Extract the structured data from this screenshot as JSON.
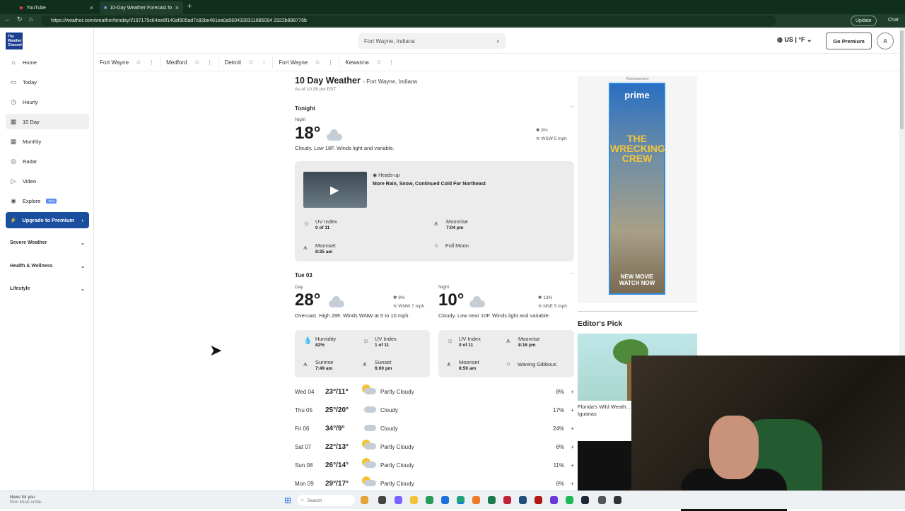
{
  "browser": {
    "tabs": [
      {
        "title": "YouTube",
        "active": false
      },
      {
        "title": "10-Day Weather Forecast for Fort...",
        "active": true
      }
    ],
    "url": "https://weather.com/weather/tenday/l/197175c64ee8f140af905ad7c82be481ea0a5604328311885094 2922b898776b",
    "update_label": "Update",
    "chat_label": "Chat"
  },
  "sidebar": {
    "logo_text": "The Weather Channel",
    "items": [
      {
        "label": "Home",
        "icon": "home-icon"
      },
      {
        "label": "Today",
        "icon": "calendar-icon"
      },
      {
        "label": "Hourly",
        "icon": "clock-icon"
      },
      {
        "label": "10 Day",
        "icon": "calendar-icon"
      },
      {
        "label": "Monthly",
        "icon": "calendar-icon"
      },
      {
        "label": "Radar",
        "icon": "radar-icon"
      },
      {
        "label": "Video",
        "icon": "play-icon"
      },
      {
        "label": "Explore",
        "icon": "compass-icon",
        "badge": "New"
      }
    ],
    "premium_label": "Upgrade to Premium",
    "sections": [
      "Severe Weather",
      "Health & Wellness",
      "Lifestyle"
    ]
  },
  "header": {
    "search_placeholder": "Fort Wayne, Indiana",
    "locale": "US | °F",
    "go_premium": "Go Premium",
    "avatar": "A"
  },
  "recent_locations": [
    "Fort Wayne",
    "Medford",
    "Detroit",
    "Fort Wayne",
    "Kewanna"
  ],
  "main": {
    "title": "10 Day Weather",
    "location": "- Fort Wayne, Indiana",
    "as_of": "As of 10:26 pm EST",
    "tonight": {
      "header": "Tonight",
      "period": "Night",
      "temp": "18°",
      "precip": "9%",
      "wind": "WSW 5 mph",
      "desc": "Cloudy. Low 18F. Winds light and variable.",
      "video_kicker": "Heads-up",
      "video_title": "More Rain, Snow, Continued Cold For Northeast",
      "details": [
        {
          "label": "UV Index",
          "value": "0 of 11"
        },
        {
          "label": "Moonrise",
          "value": "7:04 pm"
        },
        {
          "label": "Moonset",
          "value": "8:25 am"
        },
        {
          "label": "Full Moon",
          "value": ""
        }
      ]
    },
    "tue": {
      "header": "Tue 03",
      "day": {
        "period": "Day",
        "temp": "28°",
        "precip": "9%",
        "wind": "WNW 7 mph",
        "desc": "Overcast. High 28F. Winds WNW at 5 to 10 mph.",
        "details": [
          {
            "label": "Humidity",
            "value": "82%"
          },
          {
            "label": "UV Index",
            "value": "1 of 11"
          },
          {
            "label": "Sunrise",
            "value": "7:49 am"
          },
          {
            "label": "Sunset",
            "value": "6:00 pm"
          }
        ]
      },
      "night": {
        "period": "Night",
        "temp": "10°",
        "precip": "13%",
        "wind": "NNE 5 mph",
        "desc": "Cloudy. Low near 10F. Winds light and variable.",
        "details": [
          {
            "label": "UV Index",
            "value": "0 of 11"
          },
          {
            "label": "Moonrise",
            "value": "8:16 pm"
          },
          {
            "label": "Moonset",
            "value": "8:50 am"
          },
          {
            "label": "Waning Gibbous",
            "value": ""
          }
        ]
      }
    },
    "days": [
      {
        "day": "Wed 04",
        "temps": "23°/11°",
        "cond": "Partly Cloudy",
        "precip": "8%",
        "icon": "partly-cloudy-icon"
      },
      {
        "day": "Thu 05",
        "temps": "25°/20°",
        "cond": "Cloudy",
        "precip": "17%",
        "icon": "cloudy-icon"
      },
      {
        "day": "Fri 06",
        "temps": "34°/9°",
        "cond": "Cloudy",
        "precip": "24%",
        "icon": "cloudy-icon"
      },
      {
        "day": "Sat 07",
        "temps": "22°/13°",
        "cond": "Partly Cloudy",
        "precip": "6%",
        "icon": "partly-cloudy-icon"
      },
      {
        "day": "Sun 08",
        "temps": "26°/14°",
        "cond": "Partly Cloudy",
        "precip": "11%",
        "icon": "partly-cloudy-icon"
      },
      {
        "day": "Mon 09",
        "temps": "29°/17°",
        "cond": "Partly Cloudy",
        "precip": "6%",
        "icon": "partly-cloudy-icon"
      }
    ]
  },
  "right": {
    "ad_label": "Advertisement",
    "ad_brand": "prime",
    "ad_title": "THE WRECKING CREW",
    "ad_cta": "NEW MOVIE WATCH NOW",
    "editor_pick": "Editor's Pick",
    "editor_story": "Florida's Wild Weath... And Iguanas"
  },
  "taskbar": {
    "news_title": "News for you",
    "news_sub": "Elon Musk unifie...",
    "search": "Search"
  },
  "colors": {
    "premium": "#1a4fa0",
    "browser_frame": "#1f3e2b",
    "brand": "#1a3d8f"
  }
}
